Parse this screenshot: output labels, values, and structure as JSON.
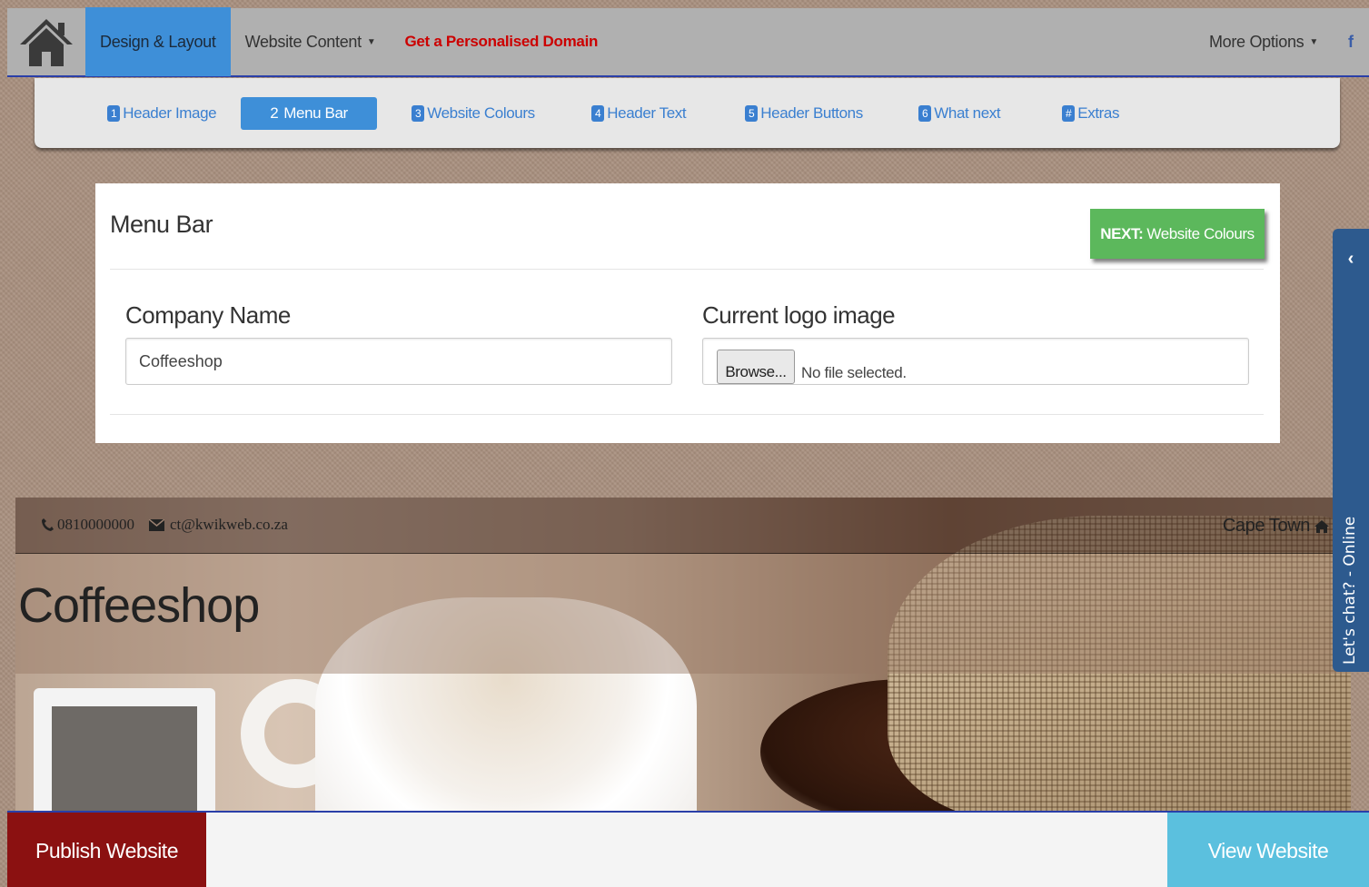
{
  "topnav": {
    "home_icon": "home-icon",
    "items": [
      {
        "label": "Design & Layout",
        "active": true
      },
      {
        "label": "Website Content",
        "dropdown": true
      },
      {
        "label": "Get a Personalised Domain",
        "highlight": true
      }
    ],
    "more_options": "More Options",
    "facebook": "f"
  },
  "steps": [
    {
      "num": "1",
      "label": "Header Image"
    },
    {
      "num": "2",
      "label": "Menu Bar",
      "active": true
    },
    {
      "num": "3",
      "label": "Website Colours"
    },
    {
      "num": "4",
      "label": "Header Text"
    },
    {
      "num": "5",
      "label": "Header Buttons"
    },
    {
      "num": "6",
      "label": "What next"
    },
    {
      "num": "#",
      "label": "Extras"
    }
  ],
  "panel": {
    "title": "Menu Bar",
    "next_prefix": "NEXT:",
    "next_label": "Website Colours",
    "company_name_label": "Company Name",
    "company_name_value": "Coffeeshop",
    "logo_label": "Current logo image",
    "browse_label": "Browse...",
    "no_file": "No file selected."
  },
  "preview": {
    "phone": "0810000000",
    "email": "ct@kwikweb.co.za",
    "location": "Cape Town",
    "brand": "Coffeeshop"
  },
  "chat": {
    "label": "Let's chat? - Online",
    "chevron": "‹"
  },
  "bottom": {
    "publish": "Publish Website",
    "view": "View Website"
  },
  "colors": {
    "accent_blue": "#3e8fd8",
    "next_green": "#5cb85c",
    "publish_red": "#8b1111",
    "view_cyan": "#5bc0de",
    "domain_red": "#cc0000",
    "chat_blue": "#2d5a8e"
  }
}
